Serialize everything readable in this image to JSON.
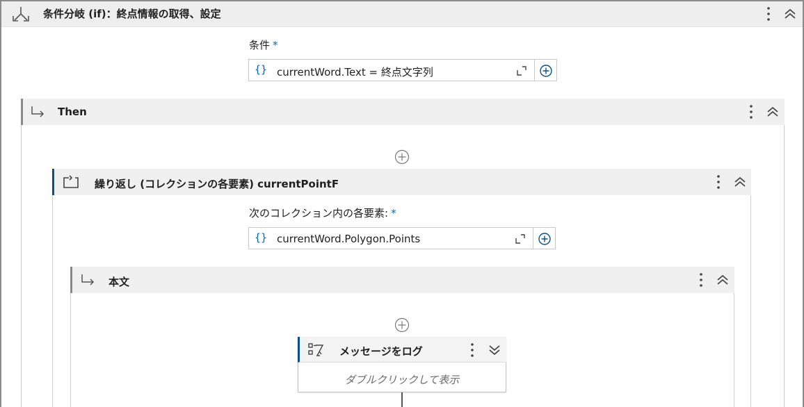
{
  "if_activity": {
    "title": "条件分岐 (if)：終点情報の取得、設定",
    "condition_label": "条件",
    "required_mark": "*",
    "condition_value": "currentWord.Text = 終点文字列",
    "brace_symbol": "{}",
    "icon": "if-branch-icon"
  },
  "then_block": {
    "label": "Then",
    "icon": "branch-arrow-icon"
  },
  "foreach_activity": {
    "title": "繰り返し (コレクションの各要素) currentPointF",
    "collection_label": "次のコレクション内の各要素:",
    "required_mark": "*",
    "collection_value": "currentWord.Polygon.Points",
    "brace_symbol": "{}",
    "icon": "loop-icon"
  },
  "body_block": {
    "label": "本文",
    "icon": "branch-arrow-icon"
  },
  "log_activity": {
    "title": "メッセージをログ",
    "hint": "ダブルクリックして表示",
    "icon": "log-message-icon"
  },
  "colors": {
    "accent_blue": "#0067c0",
    "header_bg": "#f0f0f0",
    "selected_border": "#0b4f8c"
  }
}
